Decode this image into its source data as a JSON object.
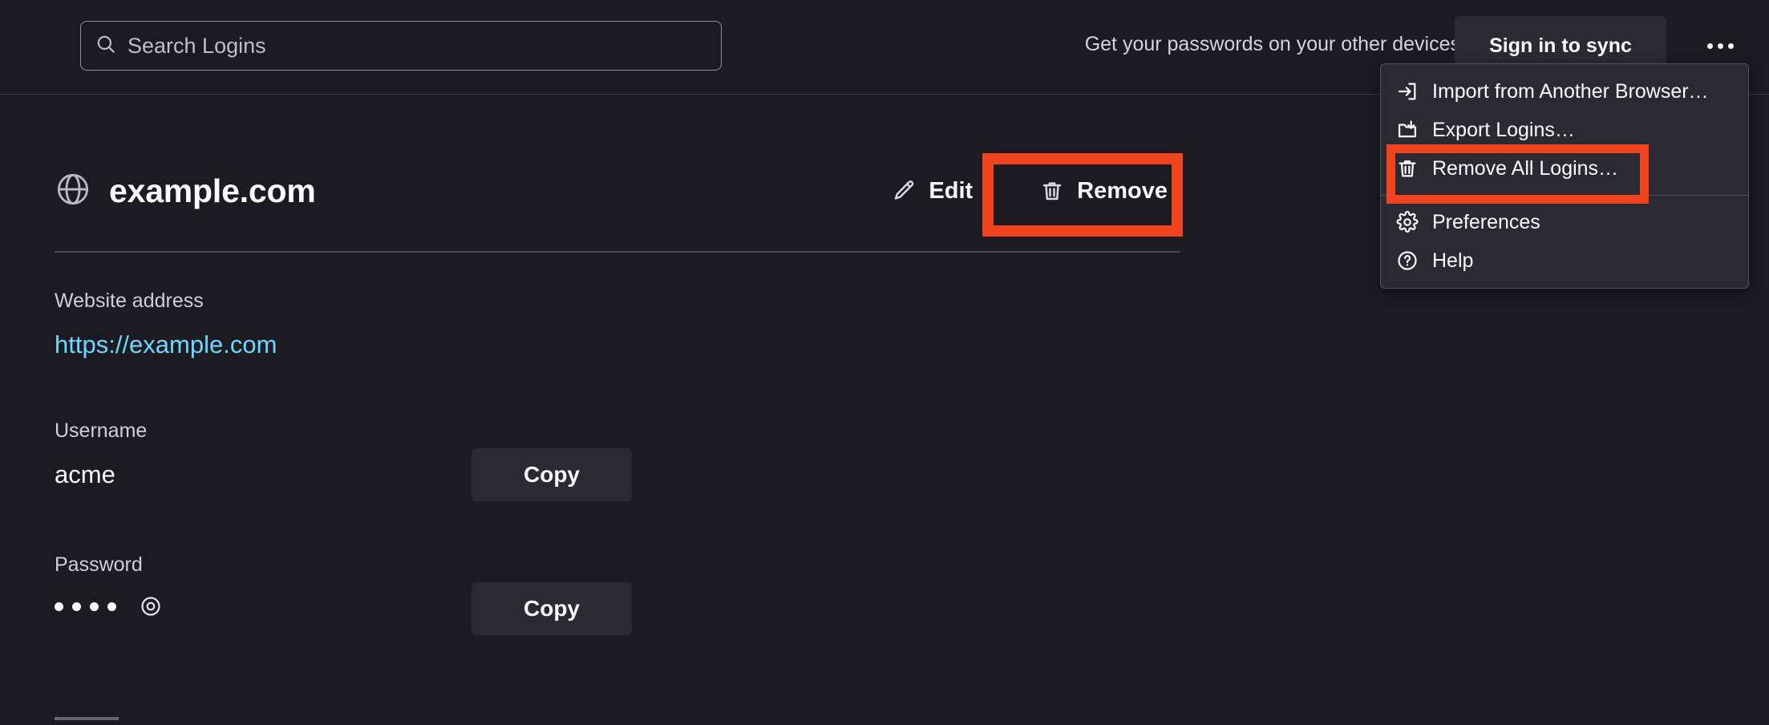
{
  "window": {
    "background_color": "#1c1b22",
    "accent_highlight_color": "#f2431f",
    "link_color": "#6ad8ff"
  },
  "header": {
    "search": {
      "placeholder": "Search Logins",
      "value": "",
      "icon": "search-icon"
    },
    "sync_message": "Get your passwords on your other devices",
    "sync_button_label": "Sign in to sync",
    "menu_button_icon": "ellipsis-icon"
  },
  "dropdown_menu": {
    "items": [
      {
        "label": "Import from Another Browser…",
        "icon": "import-icon",
        "highlighted": false
      },
      {
        "label": "Export Logins…",
        "icon": "export-icon",
        "highlighted": false
      },
      {
        "label": "Remove All Logins…",
        "icon": "trash-icon",
        "highlighted": true
      },
      {
        "label": "Preferences",
        "icon": "gear-icon",
        "highlighted": false
      },
      {
        "label": "Help",
        "icon": "help-icon",
        "highlighted": false
      }
    ]
  },
  "login_detail": {
    "site_icon": "globe-icon",
    "title": "example.com",
    "edit_button_label": "Edit",
    "edit_button_icon": "pencil-icon",
    "remove_button_label": "Remove",
    "remove_button_icon": "trash-icon",
    "fields": {
      "website": {
        "label": "Website address",
        "value": "https://example.com"
      },
      "username": {
        "label": "Username",
        "value": "acme",
        "copy_label": "Copy"
      },
      "password": {
        "label": "Password",
        "masked_value": "••••",
        "dot_count": 4,
        "copy_label": "Copy",
        "reveal_icon": "eye-icon"
      }
    }
  }
}
